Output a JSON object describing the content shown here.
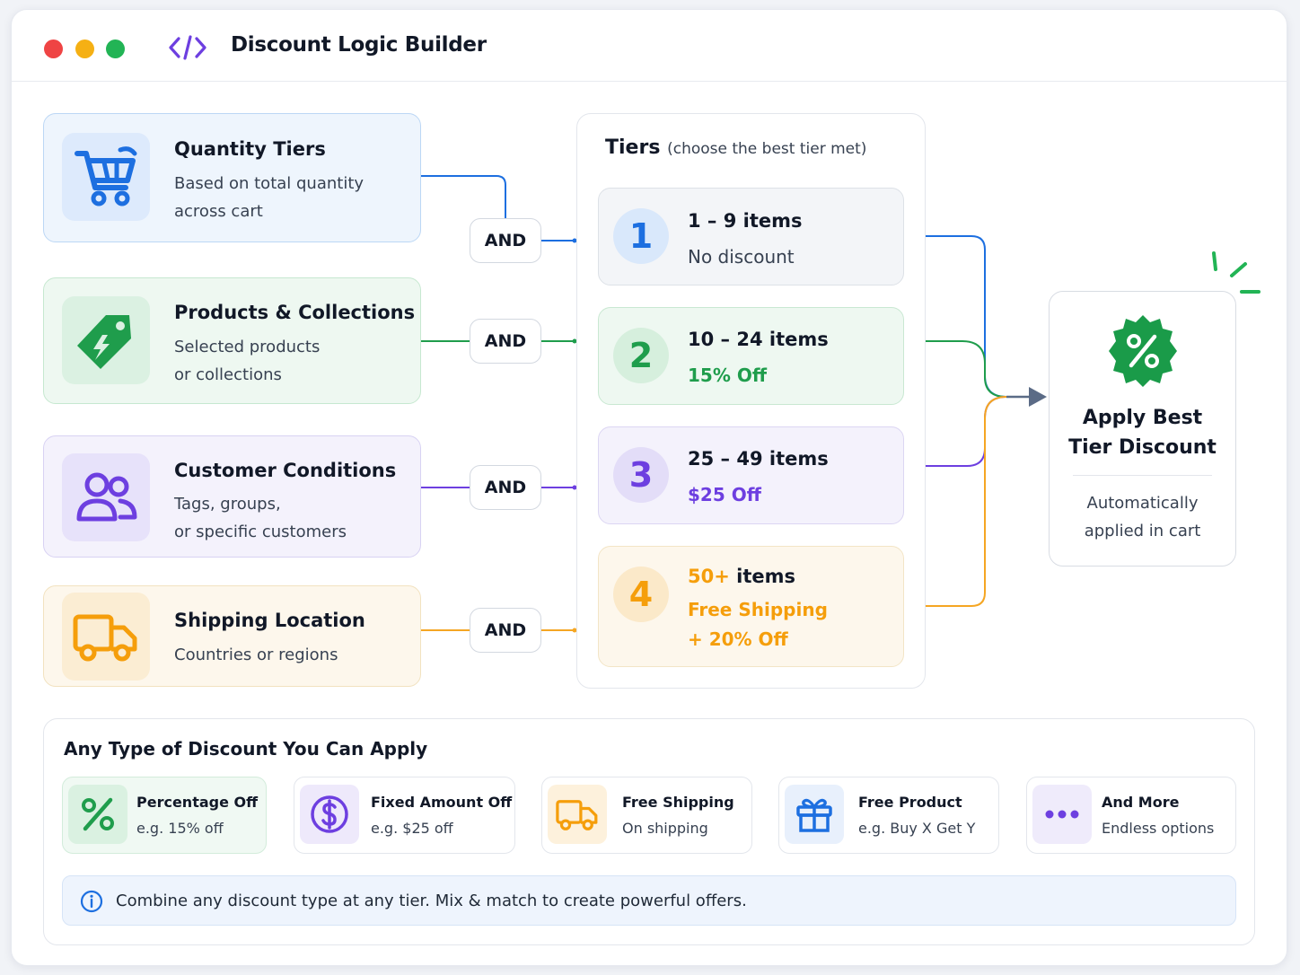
{
  "app": {
    "title": "Discount Logic Builder"
  },
  "conditions": [
    {
      "title": "Quantity Tiers",
      "subtitle_line1": "Based on total quantity",
      "subtitle_line2": "across cart",
      "icon": "shopping-cart-icon",
      "color": "#1d6fe0"
    },
    {
      "title": "Products & Collections",
      "subtitle_line1": "Selected products",
      "subtitle_line2": "or collections",
      "icon": "price-tag-icon",
      "color": "#1f9d4c"
    },
    {
      "title": "Customer Conditions",
      "subtitle_line1": "Tags, groups,",
      "subtitle_line2": "or specific customers",
      "icon": "users-icon",
      "color": "#6d3fe0"
    },
    {
      "title": "Shipping Location",
      "subtitle_line1": "Countries or regions",
      "icon": "truck-icon",
      "color": "#f59e0b"
    }
  ],
  "connector_label": "AND",
  "tiers_panel": {
    "title": "Tiers",
    "note": "(choose the best tier met)"
  },
  "tiers": [
    {
      "number": "1",
      "range": "1 – 9 items",
      "reward": "No discount",
      "color": "#1d6fe0"
    },
    {
      "number": "2",
      "range": "10 – 24 items",
      "reward": "15% Off",
      "color": "#1f9d4c"
    },
    {
      "number": "3",
      "range": "25 – 49 items",
      "reward": "$25 Off",
      "color": "#6d3fe0"
    },
    {
      "number": "4",
      "range_highlight": "50+",
      "range_rest": " items",
      "reward_line1": "Free Shipping",
      "reward_line2": "+ 20% Off",
      "color": "#f59e0b"
    }
  ],
  "result": {
    "title_line1": "Apply Best",
    "title_line2": "Tier Discount",
    "subtitle_line1": "Automatically",
    "subtitle_line2": "applied in cart",
    "icon": "percent-badge-icon",
    "color": "#1a9b49"
  },
  "discount_types": {
    "title": "Any Type of Discount You Can Apply",
    "items": [
      {
        "name": "Percentage Off",
        "example": "e.g. 15% off",
        "icon": "percent-icon"
      },
      {
        "name": "Fixed Amount Off",
        "example": "e.g. $25 off",
        "icon": "dollar-coin-icon"
      },
      {
        "name": "Free Shipping",
        "example": "On shipping",
        "icon": "truck-icon"
      },
      {
        "name": "Free Product",
        "example": "e.g. Buy X Get Y",
        "icon": "gift-icon"
      },
      {
        "name": "And More",
        "example": "Endless options",
        "icon": "more-dots-icon"
      }
    ]
  },
  "info": {
    "text": "Combine any discount type at any tier. Mix & match to create powerful offers.",
    "icon": "info-icon"
  }
}
